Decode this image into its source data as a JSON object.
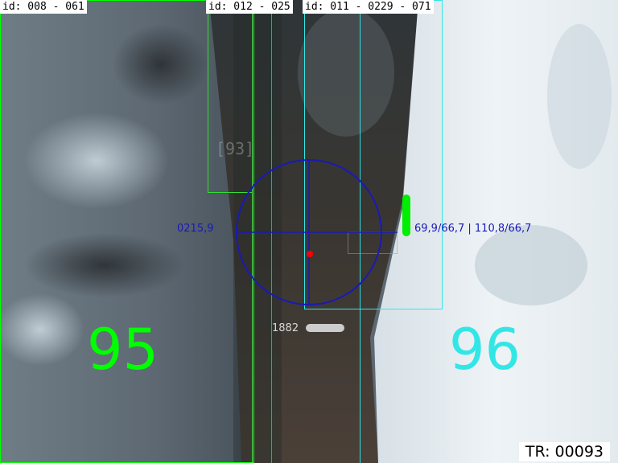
{
  "tracks": [
    {
      "id_text": "id: 008 - 061",
      "color": "#00ff00",
      "number": "95"
    },
    {
      "id_text": "id: 012 - 025",
      "color": "#33dd33"
    },
    {
      "id_text": "id: 011 - 0229 - 071",
      "color": "#33e6e6",
      "number": "96"
    }
  ],
  "ghost_label": "[93]",
  "reticle": {
    "color": "#1a1ab4",
    "left_readout": "0215,9",
    "right_readout": "69,9/66,7 | 110,8/66,7",
    "target_dot_color": "#ff0000",
    "lines": {
      "pink": "#ff3b8c",
      "green": "#44dd44",
      "cyan": "#33dddd"
    }
  },
  "depth": {
    "label": "1882",
    "bar_color": "#cccccc"
  },
  "level_indicator": {
    "color": "#00ee00"
  },
  "tr_readout": "TR: 00093"
}
